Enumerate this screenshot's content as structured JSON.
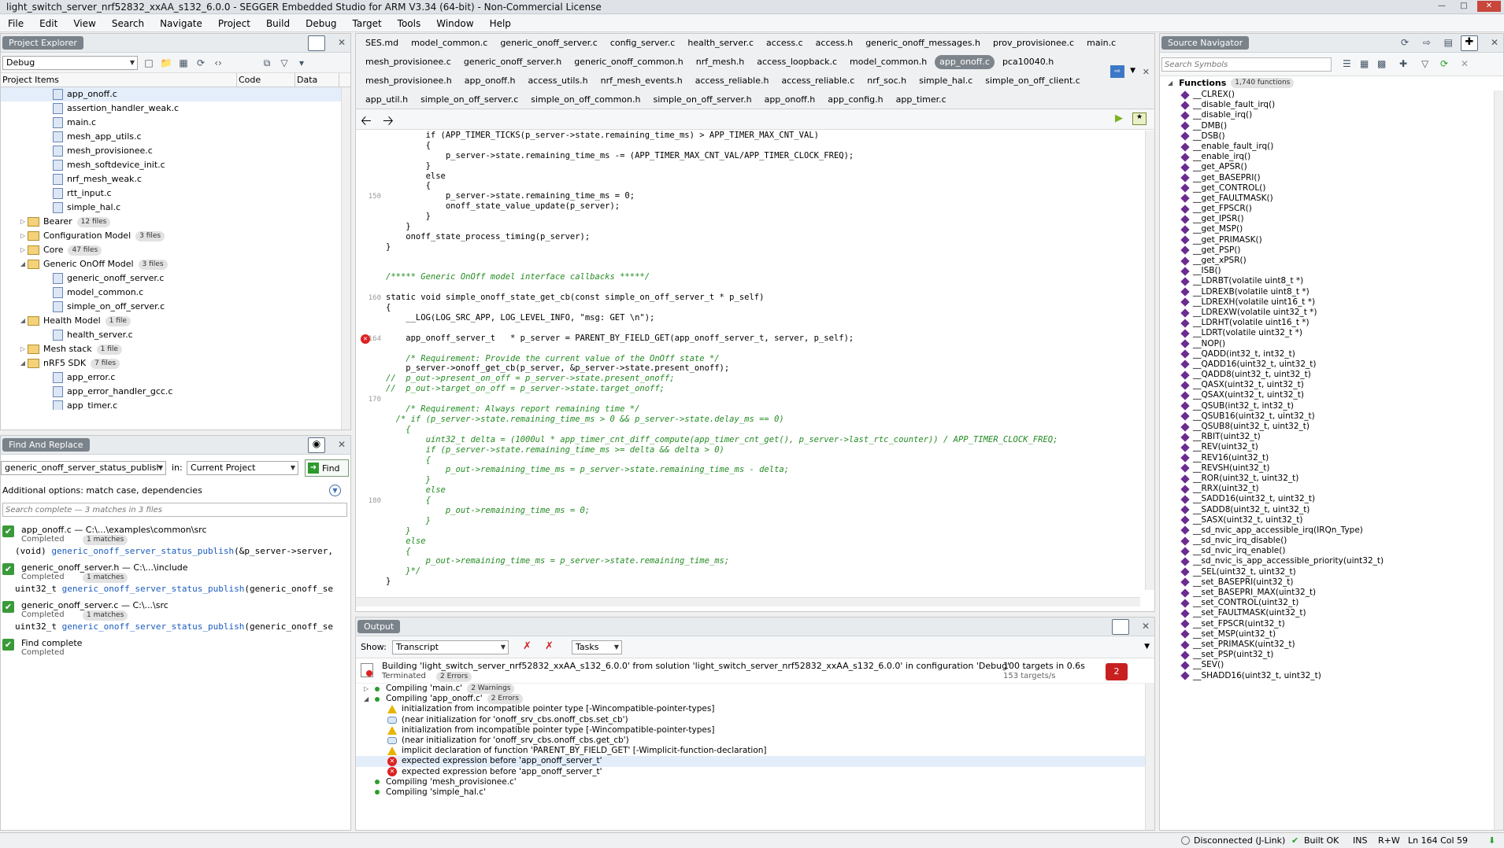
{
  "window": {
    "title": "light_switch_server_nrf52832_xxAA_s132_6.0.0 - SEGGER Embedded Studio for ARM V3.34 (64-bit) - Non-Commercial License"
  },
  "menu": [
    "File",
    "Edit",
    "View",
    "Search",
    "Navigate",
    "Project",
    "Build",
    "Debug",
    "Target",
    "Tools",
    "Window",
    "Help"
  ],
  "project_explorer": {
    "title": "Project Explorer",
    "config": "Debug",
    "columns": [
      "Project Items",
      "Code",
      "Data"
    ],
    "items": [
      {
        "label": "app_onoff.c",
        "type": "file",
        "indent": 3,
        "selected": true
      },
      {
        "label": "assertion_handler_weak.c",
        "type": "file",
        "indent": 3
      },
      {
        "label": "main.c",
        "type": "file",
        "indent": 3
      },
      {
        "label": "mesh_app_utils.c",
        "type": "file",
        "indent": 3
      },
      {
        "label": "mesh_provisionee.c",
        "type": "file",
        "indent": 3
      },
      {
        "label": "mesh_softdevice_init.c",
        "type": "file",
        "indent": 3
      },
      {
        "label": "nrf_mesh_weak.c",
        "type": "file",
        "indent": 3
      },
      {
        "label": "rtt_input.c",
        "type": "file",
        "indent": 3
      },
      {
        "label": "simple_hal.c",
        "type": "file",
        "indent": 3
      },
      {
        "label": "Bearer",
        "type": "folder",
        "indent": 1,
        "badge": "12 files",
        "open": false
      },
      {
        "label": "Configuration Model",
        "type": "folder",
        "indent": 1,
        "badge": "3 files",
        "open": false
      },
      {
        "label": "Core",
        "type": "folder",
        "indent": 1,
        "badge": "47 files",
        "open": false
      },
      {
        "label": "Generic OnOff Model",
        "type": "folder",
        "indent": 1,
        "badge": "3 files",
        "open": true
      },
      {
        "label": "generic_onoff_server.c",
        "type": "file",
        "indent": 3
      },
      {
        "label": "model_common.c",
        "type": "file",
        "indent": 3
      },
      {
        "label": "simple_on_off_server.c",
        "type": "file",
        "indent": 3
      },
      {
        "label": "Health Model",
        "type": "folder",
        "indent": 1,
        "badge": "1 file",
        "open": true
      },
      {
        "label": "health_server.c",
        "type": "file",
        "indent": 3
      },
      {
        "label": "Mesh stack",
        "type": "folder",
        "indent": 1,
        "badge": "1 file",
        "open": false
      },
      {
        "label": "nRF5 SDK",
        "type": "folder",
        "indent": 1,
        "badge": "7 files",
        "open": true
      },
      {
        "label": "app_error.c",
        "type": "file",
        "indent": 3
      },
      {
        "label": "app_error_handler_gcc.c",
        "type": "file",
        "indent": 3
      },
      {
        "label": "app_timer.c",
        "type": "file",
        "indent": 3
      }
    ]
  },
  "find_replace": {
    "title": "Find And Replace",
    "query": "generic_onoff_server_status_publish",
    "in_label": "in:",
    "scope": "Current Project",
    "find_label": "Find",
    "options": "Additional options: match case, dependencies",
    "search_placeholder": "Search complete — 3 matches in 3 files",
    "results": [
      {
        "file": "app_onoff.c — C:\\...\\examples\\common\\src",
        "status": "Completed",
        "badge": "1 matches",
        "pre": "(void) ",
        "match": "generic_onoff_server_status_publish",
        "post": "(&p_server->server,"
      },
      {
        "file": "generic_onoff_server.h — C:\\...\\include",
        "status": "Completed",
        "badge": "1 matches",
        "pre": "uint32_t ",
        "match": "generic_onoff_server_status_publish",
        "post": "(generic_onoff_se"
      },
      {
        "file": "generic_onoff_server.c — C:\\...\\src",
        "status": "Completed",
        "badge": "1 matches",
        "pre": "uint32_t ",
        "match": "generic_onoff_server_status_publish",
        "post": "(generic_onoff_se"
      }
    ],
    "complete": "Find complete",
    "complete_status": "Completed"
  },
  "editor": {
    "tab_rows": [
      [
        "SES.md",
        "model_common.c",
        "generic_onoff_server.c",
        "config_server.c",
        "health_server.c",
        "access.c",
        "access.h",
        "generic_onoff_messages.h",
        "prov_provisionee.c",
        "main.c"
      ],
      [
        "mesh_provisionee.c",
        "generic_onoff_server.h",
        "generic_onoff_common.h",
        "nrf_mesh.h",
        "access_loopback.c",
        "model_common.h",
        "app_onoff.c",
        "pca10040.h"
      ],
      [
        "mesh_provisionee.h",
        "app_onoff.h",
        "access_utils.h",
        "nrf_mesh_events.h",
        "access_reliable.h",
        "access_reliable.c",
        "nrf_soc.h",
        "simple_hal.c",
        "simple_on_off_client.c"
      ],
      [
        "app_util.h",
        "simple_on_off_server.c",
        "simple_on_off_common.h",
        "simple_on_off_server.h",
        "app_onoff.h",
        "app_config.h",
        "app_timer.c"
      ]
    ],
    "active_tab": "app_onoff.c",
    "lines": [
      {
        "n": "",
        "t": "        if (APP_TIMER_TICKS(p_server->state.remaining_time_ms) > APP_TIMER_MAX_CNT_VAL)"
      },
      {
        "n": "",
        "t": "        {"
      },
      {
        "n": "",
        "t": "            p_server->state.remaining_time_ms -= (APP_TIMER_MAX_CNT_VAL/APP_TIMER_CLOCK_FREQ);"
      },
      {
        "n": "",
        "t": "        }"
      },
      {
        "n": "",
        "t": "        else"
      },
      {
        "n": "",
        "t": "        {"
      },
      {
        "n": "150",
        "t": "            p_server->state.remaining_time_ms = 0;"
      },
      {
        "n": "",
        "t": "            onoff_state_value_update(p_server);"
      },
      {
        "n": "",
        "t": "        }"
      },
      {
        "n": "",
        "t": "    }"
      },
      {
        "n": "",
        "t": "    onoff_state_process_timing(p_server);"
      },
      {
        "n": "",
        "t": "}"
      },
      {
        "n": "",
        "t": ""
      },
      {
        "n": "",
        "t": ""
      },
      {
        "n": "",
        "t": "/***** Generic OnOff model interface callbacks *****/",
        "c": "cm"
      },
      {
        "n": "",
        "t": ""
      },
      {
        "n": "160",
        "t": "static void simple_onoff_state_get_cb(const simple_on_off_server_t * p_self)"
      },
      {
        "n": "",
        "t": "{"
      },
      {
        "n": "",
        "t": "    __LOG(LOG_SRC_APP, LOG_LEVEL_INFO, \"msg: GET \\n\");"
      },
      {
        "n": "",
        "t": ""
      },
      {
        "n": "164",
        "t": "    app_onoff_server_t   * p_server = PARENT_BY_FIELD_GET(app_onoff_server_t, server, p_self);",
        "err": true
      },
      {
        "n": "",
        "t": ""
      },
      {
        "n": "",
        "t": "    /* Requirement: Provide the current value of the OnOff state */",
        "c": "cm"
      },
      {
        "n": "",
        "t": "    p_server->onoff_get_cb(p_server, &p_server->state.present_onoff);"
      },
      {
        "n": "",
        "t": "//  p_out->present_on_off = p_server->state.present_onoff;",
        "c": "cm"
      },
      {
        "n": "",
        "t": "//  p_out->target_on_off = p_server->state.target_onoff;",
        "c": "cm"
      },
      {
        "n": "170",
        "t": ""
      },
      {
        "n": "",
        "t": "    /* Requirement: Always report remaining time */",
        "c": "cm"
      },
      {
        "n": "",
        "t": "  /* if (p_server->state.remaining_time_ms > 0 && p_server->state.delay_ms == 0)",
        "c": "cm"
      },
      {
        "n": "",
        "t": "    {",
        "c": "cm"
      },
      {
        "n": "",
        "t": "        uint32_t delta = (1000ul * app_timer_cnt_diff_compute(app_timer_cnt_get(), p_server->last_rtc_counter)) / APP_TIMER_CLOCK_FREQ;",
        "c": "cm"
      },
      {
        "n": "",
        "t": "        if (p_server->state.remaining_time_ms >= delta && delta > 0)",
        "c": "cm"
      },
      {
        "n": "",
        "t": "        {",
        "c": "cm"
      },
      {
        "n": "",
        "t": "            p_out->remaining_time_ms = p_server->state.remaining_time_ms - delta;",
        "c": "cm"
      },
      {
        "n": "",
        "t": "        }",
        "c": "cm"
      },
      {
        "n": "",
        "t": "        else",
        "c": "cm"
      },
      {
        "n": "180",
        "t": "        {",
        "c": "cm"
      },
      {
        "n": "",
        "t": "            p_out->remaining_time_ms = 0;",
        "c": "cm"
      },
      {
        "n": "",
        "t": "        }",
        "c": "cm"
      },
      {
        "n": "",
        "t": "    }",
        "c": "cm"
      },
      {
        "n": "",
        "t": "    else",
        "c": "cm"
      },
      {
        "n": "",
        "t": "    {",
        "c": "cm"
      },
      {
        "n": "",
        "t": "        p_out->remaining_time_ms = p_server->state.remaining_time_ms;",
        "c": "cm"
      },
      {
        "n": "",
        "t": "    }*/",
        "c": "cm"
      },
      {
        "n": "",
        "t": "}"
      }
    ]
  },
  "output": {
    "title": "Output",
    "show_label": "Show:",
    "show_value": "Transcript",
    "tasks_value": "Tasks",
    "build_line": "Building 'light_switch_server_nrf52832_xxAA_s132_6.0.0' from solution 'light_switch_server_nrf52832_xxAA_s132_6.0.0' in configuration 'Debug'",
    "build_status": "Terminated",
    "build_badge": "2 Errors",
    "targets": "100 targets in 0.6s",
    "rate": "153 targets/s",
    "error_count": "2",
    "rows": [
      {
        "icon": "dot",
        "text": "Compiling 'main.c'",
        "badge": "2 Warnings",
        "indent": 1
      },
      {
        "icon": "dot",
        "text": "Compiling 'app_onoff.c'",
        "badge": "2 Errors",
        "indent": 1
      },
      {
        "icon": "warn",
        "text": "initialization from incompatible pointer type [-Wincompatible-pointer-types]",
        "indent": 2
      },
      {
        "icon": "note",
        "text": "(near initialization for 'onoff_srv_cbs.onoff_cbs.set_cb')",
        "indent": 2
      },
      {
        "icon": "warn",
        "text": "initialization from incompatible pointer type [-Wincompatible-pointer-types]",
        "indent": 2
      },
      {
        "icon": "note",
        "text": "(near initialization for 'onoff_srv_cbs.onoff_cbs.get_cb')",
        "indent": 2
      },
      {
        "icon": "warn",
        "text": "implicit declaration of function 'PARENT_BY_FIELD_GET' [-Wimplicit-function-declaration]",
        "indent": 2
      },
      {
        "icon": "err",
        "text": "expected expression before 'app_onoff_server_t'",
        "indent": 2,
        "sel": true
      },
      {
        "icon": "err",
        "text": "expected expression before 'app_onoff_server_t'",
        "indent": 2
      },
      {
        "icon": "dot",
        "text": "Compiling 'mesh_provisionee.c'",
        "indent": 1
      },
      {
        "icon": "dot",
        "text": "Compiling 'simple_hal.c'",
        "indent": 1
      }
    ]
  },
  "source_navigator": {
    "title": "Source Navigator",
    "search_placeholder": "Search Symbols",
    "section": "Functions",
    "count": "1,740 functions",
    "functions": [
      "__CLREX()",
      "__disable_fault_irq()",
      "__disable_irq()",
      "__DMB()",
      "__DSB()",
      "__enable_fault_irq()",
      "__enable_irq()",
      "__get_APSR()",
      "__get_BASEPRI()",
      "__get_CONTROL()",
      "__get_FAULTMASK()",
      "__get_FPSCR()",
      "__get_IPSR()",
      "__get_MSP()",
      "__get_PRIMASK()",
      "__get_PSP()",
      "__get_xPSR()",
      "__ISB()",
      "__LDRBT(volatile uint8_t *)",
      "__LDREXB(volatile uint8_t *)",
      "__LDREXH(volatile uint16_t *)",
      "__LDREXW(volatile uint32_t *)",
      "__LDRHT(volatile uint16_t *)",
      "__LDRT(volatile uint32_t *)",
      "__NOP()",
      "__QADD(int32_t, int32_t)",
      "__QADD16(uint32_t, uint32_t)",
      "__QADD8(uint32_t, uint32_t)",
      "__QASX(uint32_t, uint32_t)",
      "__QSAX(uint32_t, uint32_t)",
      "__QSUB(int32_t, int32_t)",
      "__QSUB16(uint32_t, uint32_t)",
      "__QSUB8(uint32_t, uint32_t)",
      "__RBIT(uint32_t)",
      "__REV(uint32_t)",
      "__REV16(uint32_t)",
      "__REVSH(uint32_t)",
      "__ROR(uint32_t, uint32_t)",
      "__RRX(uint32_t)",
      "__SADD16(uint32_t, uint32_t)",
      "__SADD8(uint32_t, uint32_t)",
      "__SASX(uint32_t, uint32_t)",
      "__sd_nvic_app_accessible_irq(IRQn_Type)",
      "__sd_nvic_irq_disable()",
      "__sd_nvic_irq_enable()",
      "__sd_nvic_is_app_accessible_priority(uint32_t)",
      "__SEL(uint32_t, uint32_t)",
      "__set_BASEPRI(uint32_t)",
      "__set_BASEPRI_MAX(uint32_t)",
      "__set_CONTROL(uint32_t)",
      "__set_FAULTMASK(uint32_t)",
      "__set_FPSCR(uint32_t)",
      "__set_MSP(uint32_t)",
      "__set_PRIMASK(uint32_t)",
      "__set_PSP(uint32_t)",
      "__SEV()",
      "__SHADD16(uint32_t, uint32_t)"
    ]
  },
  "status": {
    "connection": "Disconnected (J-Link)",
    "build": "Built OK",
    "ins": "INS",
    "rw": "R+W",
    "pos": "Ln 164 Col 59"
  }
}
